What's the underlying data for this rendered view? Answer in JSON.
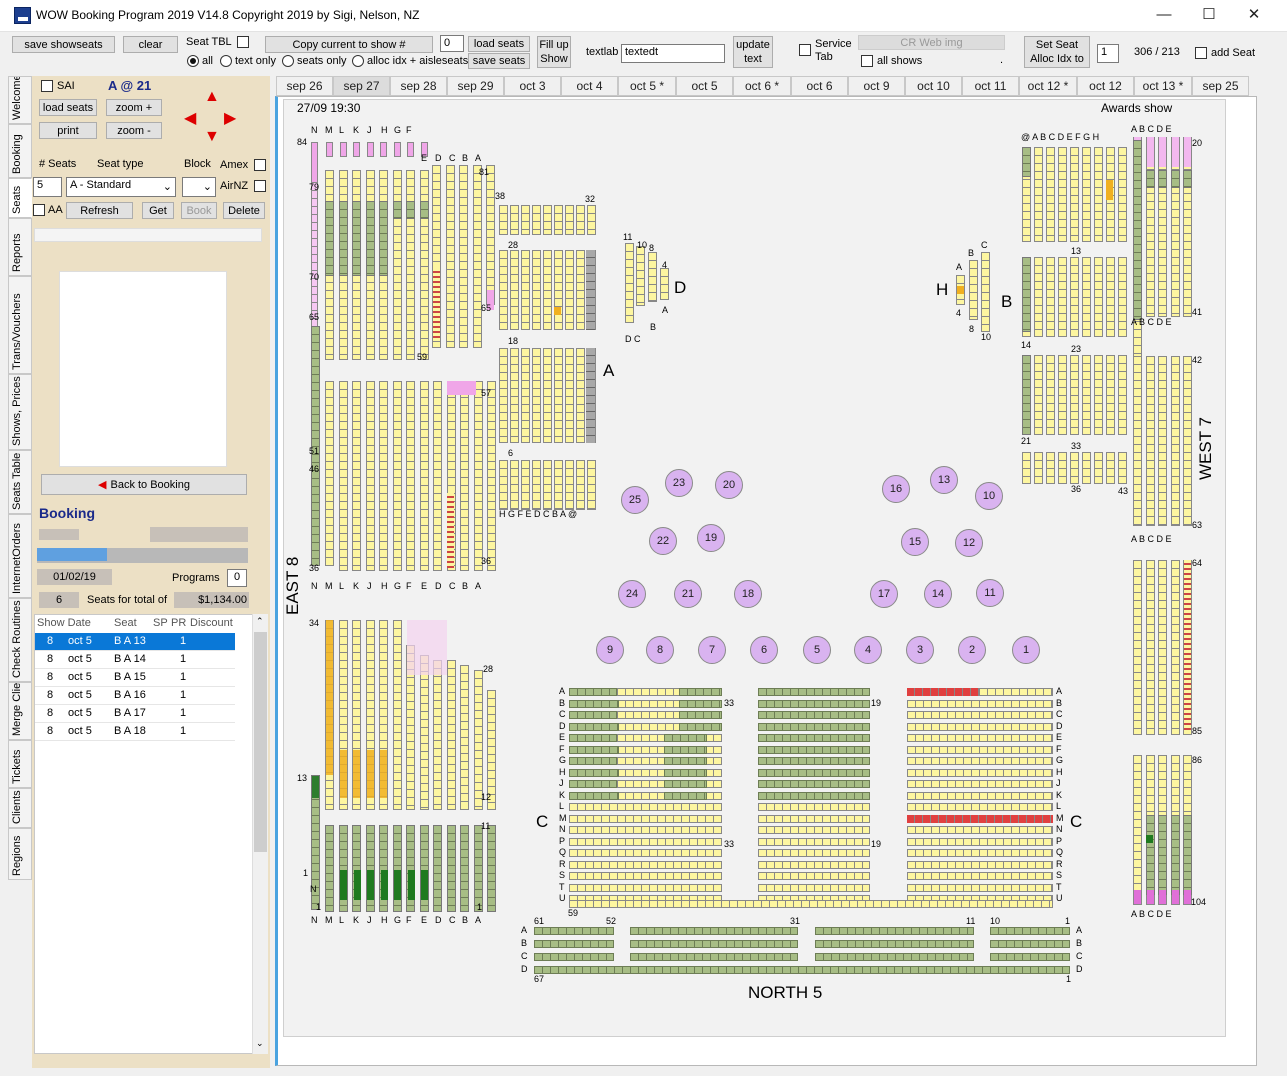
{
  "window": {
    "title": "WOW Booking Program 2019   V14.8 Copyright  2019   by Sigi, Nelson, NZ"
  },
  "toolbar": {
    "save_showseats": "save showseats",
    "clear": "clear",
    "seat_tbl": "Seat TBL",
    "radio_all": "all",
    "radio_text_only": "text only",
    "radio_seats_only": "seats only",
    "radio_alloc": "alloc idx + aisleseats",
    "copy_current": "Copy current to show #",
    "copy_value": "0",
    "load_seats": "load seats",
    "save_seats": "save seats",
    "fill_up_1": "Fill up",
    "fill_up_2": "Show",
    "textlab_label": "textlab",
    "textlab_value": "textedt",
    "update_1": "update",
    "update_2": "text",
    "service_1": "Service",
    "service_2": "Tab",
    "cr_web_img": "CR Web img",
    "all_shows": "all shows",
    "dot": ".",
    "set_seat_1": "Set Seat",
    "set_seat_2": "Alloc Idx to",
    "alloc_value": "1",
    "count": "306 / 213",
    "add_seat": "add Seat"
  },
  "vtabs": [
    "Welcome",
    "Booking",
    "Seats",
    "Reports",
    "Trans/Vouchers",
    "Shows, Prices",
    "Seats Table",
    "InternetOrders",
    "Check Routines",
    "Merge Clients",
    "Tickets",
    "Clients",
    "Regions"
  ],
  "panel": {
    "sai": "SAI",
    "seat_ref": "A @ 21",
    "load_seats": "load seats",
    "zoom_in": "zoom +",
    "print": "print",
    "zoom_out": "zoom -",
    "num_seats": "# Seats",
    "seat_type": "Seat type",
    "block": "Block",
    "amex": "Amex",
    "airnz": "AirNZ",
    "num_value": "5",
    "seat_type_value": "A - Standard",
    "aa": "AA",
    "refresh": "Refresh",
    "get": "Get",
    "book": "Book",
    "delete": "Delete",
    "back": "Back to Booking",
    "booking_title": "Booking",
    "date": "01/02/19",
    "programs": "Programs",
    "programs_value": "0",
    "seats_count": "6",
    "seats_for_total": "Seats  for  total of",
    "total": "$1,134.00"
  },
  "table": {
    "headers": [
      "Show Date",
      "Seat",
      "SP",
      "PR",
      "Discount"
    ],
    "rows": [
      {
        "n": "8",
        "date": "oct 5",
        "seat": "B A 13",
        "pr": "1"
      },
      {
        "n": "8",
        "date": "oct 5",
        "seat": "B A 14",
        "pr": "1"
      },
      {
        "n": "8",
        "date": "oct 5",
        "seat": "B A 15",
        "pr": "1"
      },
      {
        "n": "8",
        "date": "oct 5",
        "seat": "B A 16",
        "pr": "1"
      },
      {
        "n": "8",
        "date": "oct 5",
        "seat": "B A 17",
        "pr": "1"
      },
      {
        "n": "8",
        "date": "oct 5",
        "seat": "B A 18",
        "pr": "1"
      }
    ]
  },
  "show_tabs": [
    "sep 26",
    "sep 27",
    "sep 28",
    "sep 29",
    "oct 3",
    "oct 4",
    "oct 5 *",
    "oct 5",
    "oct 6 *",
    "oct 6",
    "oct 9",
    "oct 10",
    "oct 11",
    "oct 12 *",
    "oct 12",
    "oct 13 *",
    "sep 25"
  ],
  "active_tab": "sep 27",
  "chart": {
    "datetime": "27/09 19:30",
    "show_name": "Awards show",
    "east": "EAST  8",
    "west": "WEST  7",
    "north": "NORTH    5",
    "sec_a": "A",
    "sec_b": "B",
    "sec_c": "C",
    "sec_d": "D",
    "sec_h": "H",
    "tables": [
      "23",
      "20",
      "25",
      "22",
      "19",
      "24",
      "21",
      "18",
      "16",
      "13",
      "10",
      "15",
      "12",
      "17",
      "14",
      "11",
      "9",
      "8",
      "7",
      "6",
      "5",
      "4",
      "3",
      "2",
      "1"
    ],
    "east_top_letters": [
      "N",
      "M",
      "L",
      "K",
      "J",
      "H",
      "G",
      "F"
    ],
    "east_letters": [
      "E",
      "D",
      "C",
      "B",
      "A"
    ],
    "east_bottom_letters": [
      "N",
      "M",
      "L",
      "K",
      "J",
      "H",
      "G",
      "F",
      "E",
      "D",
      "C",
      "B",
      "A"
    ],
    "nums": {
      "n84": "84",
      "n81": "81",
      "n79": "79",
      "n70": "70",
      "n65l": "65",
      "n65": "65",
      "n59": "59",
      "n57": "57",
      "n51": "51",
      "n46": "46",
      "n36": "36",
      "n36b": "36",
      "n34": "34",
      "n28": "28",
      "n13": "13",
      "n12": "12",
      "n11": "11",
      "n1": "1",
      "n1b": "1",
      "n1c": "1"
    },
    "a_letters": "H G F E D C B A @",
    "a_nums": {
      "n38": "38",
      "n32": "32",
      "n28": "28",
      "n18": "18",
      "n6": "6"
    },
    "d_nums": {
      "n11": "11",
      "n10": "10",
      "n8": "8",
      "n4": "4"
    },
    "d_bottom": "D C",
    "d_side_a": "A",
    "d_side_b": "B",
    "h_letters": {
      "a": "A",
      "b": "B",
      "c": "C",
      "n4": "4",
      "n8": "8",
      "n10": "10"
    },
    "west_top_letters": "@ A B C D E F G H",
    "west_cols": "A B C D E",
    "west_nums": {
      "n20": "20",
      "n13": "13",
      "n41": "41",
      "n14": "14",
      "n23": "23",
      "n21": "21",
      "n33": "33",
      "n36": "36",
      "n43": "43",
      "n42": "42",
      "n63": "63",
      "n64": "64",
      "n85": "85",
      "n86": "86",
      "n104": "104"
    },
    "c_rows": [
      "A",
      "B",
      "C",
      "D",
      "E",
      "F",
      "G",
      "H",
      "J",
      "K",
      "L",
      "M",
      "N",
      "P",
      "Q",
      "R",
      "S",
      "T",
      "U"
    ],
    "c_nums": {
      "n33": "33",
      "n33b": "33",
      "n19": "19",
      "n19b": "19",
      "n59": "59"
    },
    "north_rows": [
      "A",
      "B",
      "C",
      "D"
    ],
    "north_nums": {
      "n61": "61",
      "n52": "52",
      "n31": "31",
      "n11": "11",
      "n10": "10",
      "n1": "1",
      "n67": "67",
      "n1b": "1"
    }
  }
}
